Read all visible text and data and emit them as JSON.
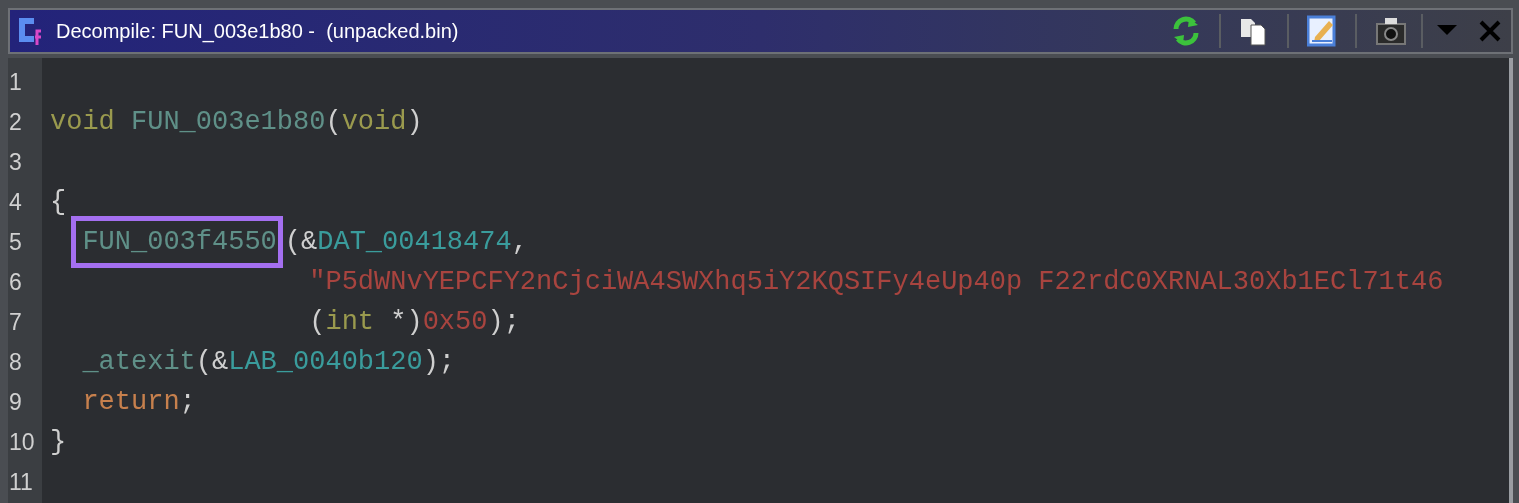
{
  "window": {
    "title": "Decompile: FUN_003e1b80 -  (unpacked.bin)"
  },
  "lines": [
    {
      "number": "1"
    },
    {
      "number": "2",
      "kind": "top",
      "tokens": [
        {
          "kind": "keyword",
          "text": "void"
        },
        {
          "kind": "function",
          "text": "FUN_003e1b80",
          "spaced": true
        },
        {
          "kind": "plain",
          "text": "("
        },
        {
          "kind": "keyword",
          "text": "void"
        },
        {
          "kind": "plain",
          "text": ")"
        }
      ]
    },
    {
      "number": "3"
    },
    {
      "number": "4",
      "kind": "top",
      "tokens": [
        {
          "kind": "plain",
          "text": "{"
        }
      ]
    },
    {
      "number": "5",
      "kind": "body",
      "tokens": [
        {
          "kind": "function",
          "text": "FUN_003f4550",
          "highlighted": true
        },
        {
          "kind": "plain",
          "text": "(&"
        },
        {
          "kind": "variable",
          "text": "DAT_00418474"
        },
        {
          "kind": "plain",
          "text": ","
        }
      ]
    },
    {
      "number": "6",
      "kind": "continuation",
      "tokens": [
        {
          "kind": "string",
          "text": "\"P5dWNvYEPCFY2nCjciWA4SWXhq5iY2KQSIFy4eUp40p F22rdC0XRNAL30Xb1ECl71t46"
        }
      ]
    },
    {
      "number": "7",
      "kind": "continuation",
      "tokens": [
        {
          "kind": "plain",
          "text": "("
        },
        {
          "kind": "keyword",
          "text": "int"
        },
        {
          "kind": "plain",
          "text": " *)"
        },
        {
          "kind": "number",
          "text": "0x50"
        },
        {
          "kind": "plain",
          "text": ");"
        }
      ]
    },
    {
      "number": "8",
      "kind": "body",
      "tokens": [
        {
          "kind": "function",
          "text": "_atexit"
        },
        {
          "kind": "plain",
          "text": "(&"
        },
        {
          "kind": "variable",
          "text": "LAB_0040b120"
        },
        {
          "kind": "plain",
          "text": ");"
        }
      ]
    },
    {
      "number": "9",
      "kind": "body",
      "tokens": [
        {
          "kind": "control",
          "text": "return"
        },
        {
          "kind": "plain",
          "text": ";"
        }
      ]
    },
    {
      "number": "10",
      "kind": "top",
      "tokens": [
        {
          "kind": "plain",
          "text": "}"
        }
      ]
    },
    {
      "number": "11"
    }
  ]
}
